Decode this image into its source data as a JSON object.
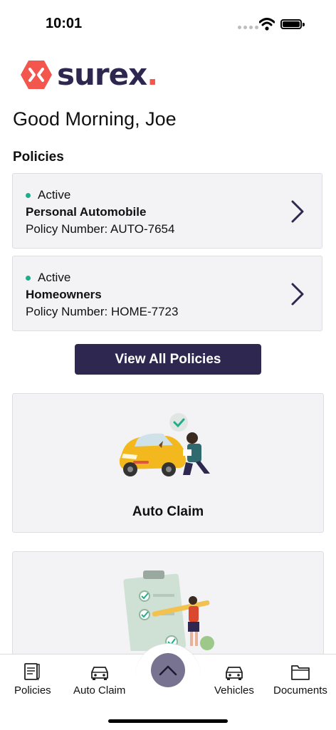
{
  "status_bar": {
    "time": "10:01"
  },
  "brand": {
    "name": "surex",
    "dot": ".",
    "accent_color": "#f2564c",
    "brand_color": "#2e2850"
  },
  "greeting": "Good Morning, Joe",
  "policies_section": {
    "title": "Policies",
    "items": [
      {
        "status": "Active",
        "name": "Personal Automobile",
        "number": "Policy Number: AUTO-7654",
        "status_color": "#1fae8c"
      },
      {
        "status": "Active",
        "name": "Homeowners",
        "number": "Policy Number: HOME-7723",
        "status_color": "#1fae8c"
      }
    ],
    "view_all_label": "View All Policies"
  },
  "cards": [
    {
      "label": "Auto Claim",
      "illustration": "car-damage-inspection-illustration"
    },
    {
      "label": "",
      "illustration": "checklist-clipboard-illustration"
    }
  ],
  "tabbar": {
    "items": [
      {
        "label": "Policies",
        "icon": "policy-document-icon"
      },
      {
        "label": "Auto Claim",
        "icon": "car-icon"
      },
      {
        "label": "Vehicles",
        "icon": "car-icon"
      },
      {
        "label": "Documents",
        "icon": "folder-icon"
      }
    ],
    "fab_icon": "chevron-up-icon"
  }
}
